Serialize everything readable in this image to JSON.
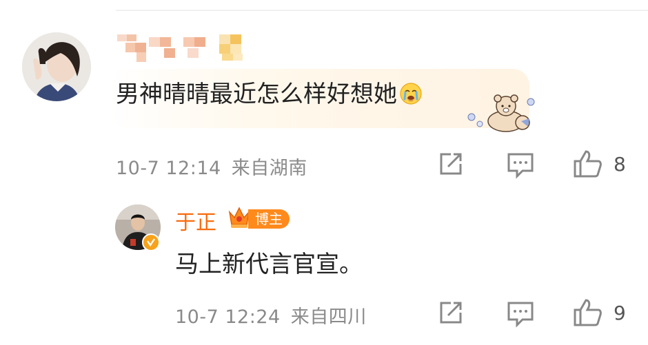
{
  "comment1": {
    "text": "男神晴晴最近怎么样好想她",
    "emoji": "crying-face-emoji",
    "sticker": "teddy-bear-sticker",
    "time": "10-7 12:14",
    "location": "来自湖南",
    "like_count": "8"
  },
  "reply": {
    "author": "于正",
    "badge": "博主",
    "text": "马上新代言官宣。",
    "time": "10-7 12:24",
    "location": "来自四川",
    "like_count": "9"
  },
  "colors": {
    "author_name": "#f76c0e",
    "badge_bg": "#ff8a1c",
    "meta_text": "#8a8a8a",
    "icon": "#888888"
  }
}
